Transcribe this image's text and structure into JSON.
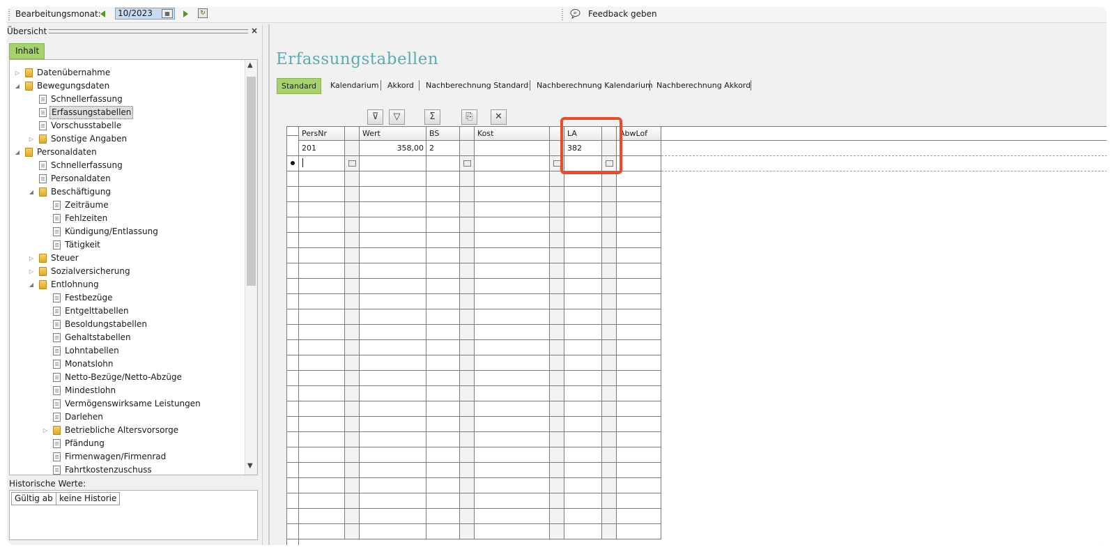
{
  "topbar": {
    "month_label": "Bearbeitungsmonat:",
    "month_value": "10/2023",
    "feedback_label": "Feedback geben"
  },
  "left_panel": {
    "title": "Übersicht",
    "tab_label": "Inhalt",
    "tree": [
      {
        "label": "Datenübernahme",
        "type": "folder",
        "level": 0,
        "expander": "collapsed"
      },
      {
        "label": "Bewegungsdaten",
        "type": "folder",
        "level": 0,
        "expander": "expanded"
      },
      {
        "label": "Schnellerfassung",
        "type": "doc",
        "level": 1,
        "expander": "none"
      },
      {
        "label": "Erfassungstabellen",
        "type": "doc",
        "level": 1,
        "expander": "none",
        "selected": true
      },
      {
        "label": "Vorschusstabelle",
        "type": "doc",
        "level": 1,
        "expander": "none"
      },
      {
        "label": "Sonstige Angaben",
        "type": "folder",
        "level": 1,
        "expander": "collapsed"
      },
      {
        "label": "Personaldaten",
        "type": "folder",
        "level": 0,
        "expander": "expanded"
      },
      {
        "label": "Schnellerfassung",
        "type": "doc",
        "level": 1,
        "expander": "none"
      },
      {
        "label": "Personaldaten",
        "type": "doc",
        "level": 1,
        "expander": "none"
      },
      {
        "label": "Beschäftigung",
        "type": "folder",
        "level": 1,
        "expander": "expanded"
      },
      {
        "label": "Zeiträume",
        "type": "doc",
        "level": 2,
        "expander": "none"
      },
      {
        "label": "Fehlzeiten",
        "type": "doc",
        "level": 2,
        "expander": "none"
      },
      {
        "label": "Kündigung/Entlassung",
        "type": "doc",
        "level": 2,
        "expander": "none"
      },
      {
        "label": "Tätigkeit",
        "type": "doc",
        "level": 2,
        "expander": "none"
      },
      {
        "label": "Steuer",
        "type": "folder",
        "level": 1,
        "expander": "collapsed"
      },
      {
        "label": "Sozialversicherung",
        "type": "folder",
        "level": 1,
        "expander": "collapsed"
      },
      {
        "label": "Entlohnung",
        "type": "folder",
        "level": 1,
        "expander": "expanded"
      },
      {
        "label": "Festbezüge",
        "type": "doc",
        "level": 2,
        "expander": "none"
      },
      {
        "label": "Entgelttabellen",
        "type": "doc",
        "level": 2,
        "expander": "none"
      },
      {
        "label": "Besoldungstabellen",
        "type": "doc",
        "level": 2,
        "expander": "none"
      },
      {
        "label": "Gehaltstabellen",
        "type": "doc",
        "level": 2,
        "expander": "none"
      },
      {
        "label": "Lohntabellen",
        "type": "doc",
        "level": 2,
        "expander": "none"
      },
      {
        "label": "Monatslohn",
        "type": "doc",
        "level": 2,
        "expander": "none"
      },
      {
        "label": "Netto-Bezüge/Netto-Abzüge",
        "type": "doc",
        "level": 2,
        "expander": "none"
      },
      {
        "label": "Mindestlohn",
        "type": "doc",
        "level": 2,
        "expander": "none"
      },
      {
        "label": "Vermögenswirksame Leistungen",
        "type": "doc",
        "level": 2,
        "expander": "none"
      },
      {
        "label": "Darlehen",
        "type": "doc",
        "level": 2,
        "expander": "none"
      },
      {
        "label": "Betriebliche Altersvorsorge",
        "type": "folder",
        "level": 2,
        "expander": "collapsed"
      },
      {
        "label": "Pfändung",
        "type": "doc",
        "level": 2,
        "expander": "none"
      },
      {
        "label": "Firmenwagen/Firmenrad",
        "type": "doc",
        "level": 2,
        "expander": "none"
      },
      {
        "label": "Fahrtkostenzuschuss",
        "type": "doc",
        "level": 2,
        "expander": "none"
      }
    ],
    "history_label": "Historische Werte:",
    "history_col1": "Gültig ab",
    "history_col2": "keine Historie"
  },
  "content": {
    "title": "Erfassungstabellen",
    "tabs": [
      "Standard",
      "Kalendarium",
      "Akkord",
      "Nachberechnung Standard",
      "Nachberechnung Kalendarium",
      "Nachberechnung Akkord"
    ],
    "toolbar_icons": [
      "filter-edit-icon",
      "filter-icon",
      "sum-icon",
      "copy-icon",
      "delete-icon"
    ]
  },
  "grid": {
    "columns": [
      "PersNr",
      "Wert",
      "BS",
      "Kost",
      "LA",
      "AbwLof"
    ],
    "rows": [
      {
        "PersNr": "201",
        "Wert": "358,00",
        "BS": "2",
        "Kost": "",
        "LA": "382",
        "AbwLof": ""
      }
    ]
  },
  "colors": {
    "accent_green": "#a6d26e",
    "title_teal": "#5aacb4",
    "highlight_red": "#ec4a2a"
  }
}
